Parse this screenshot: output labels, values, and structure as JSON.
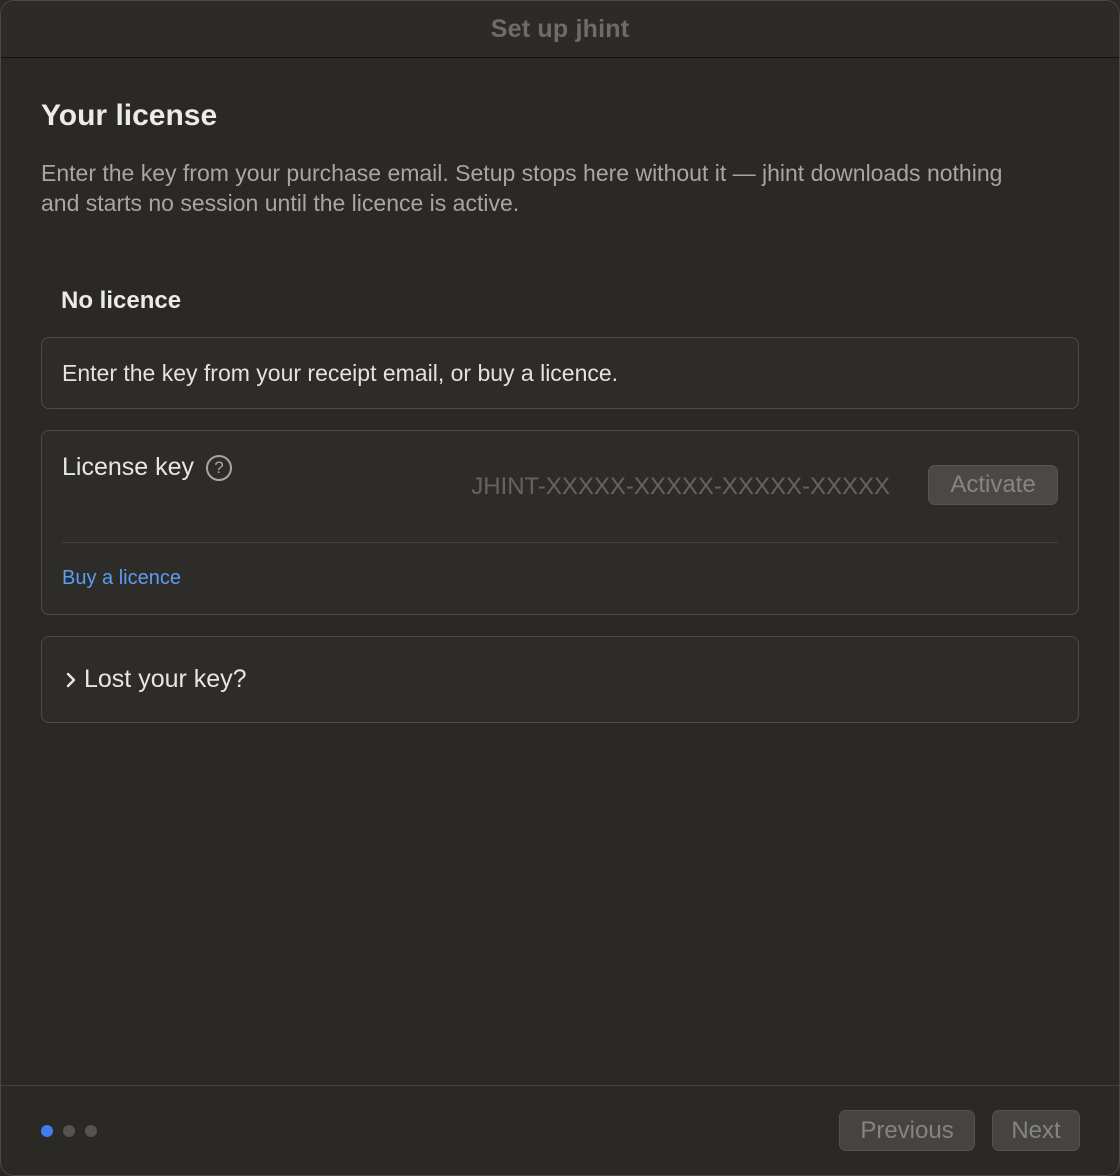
{
  "window": {
    "title": "Set up jhint"
  },
  "page": {
    "title": "Your license",
    "intro": "Enter the key from your purchase email. Setup stops here without it — jhint downloads nothing and starts no session until the licence is active."
  },
  "licence_status": {
    "heading": "No licence",
    "message": "Enter the key from your receipt email, or buy a licence."
  },
  "license_form": {
    "label": "License key",
    "help_icon": "question-circle-icon",
    "help_glyph": "?",
    "key_value": "",
    "key_placeholder": "JHINT-XXXXX-XXXXX-XXXXX-XXXXX",
    "activate_label": "Activate",
    "buy_link": "Buy a licence"
  },
  "lost_key": {
    "icon": "chevron-right-icon",
    "label": "Lost your key?"
  },
  "footer": {
    "steps_total": 3,
    "current_step": 1,
    "previous_label": "Previous",
    "next_label": "Next"
  },
  "colors": {
    "background": "#2a2925",
    "accent": "#3e7ef0",
    "link": "#5a9df5"
  }
}
